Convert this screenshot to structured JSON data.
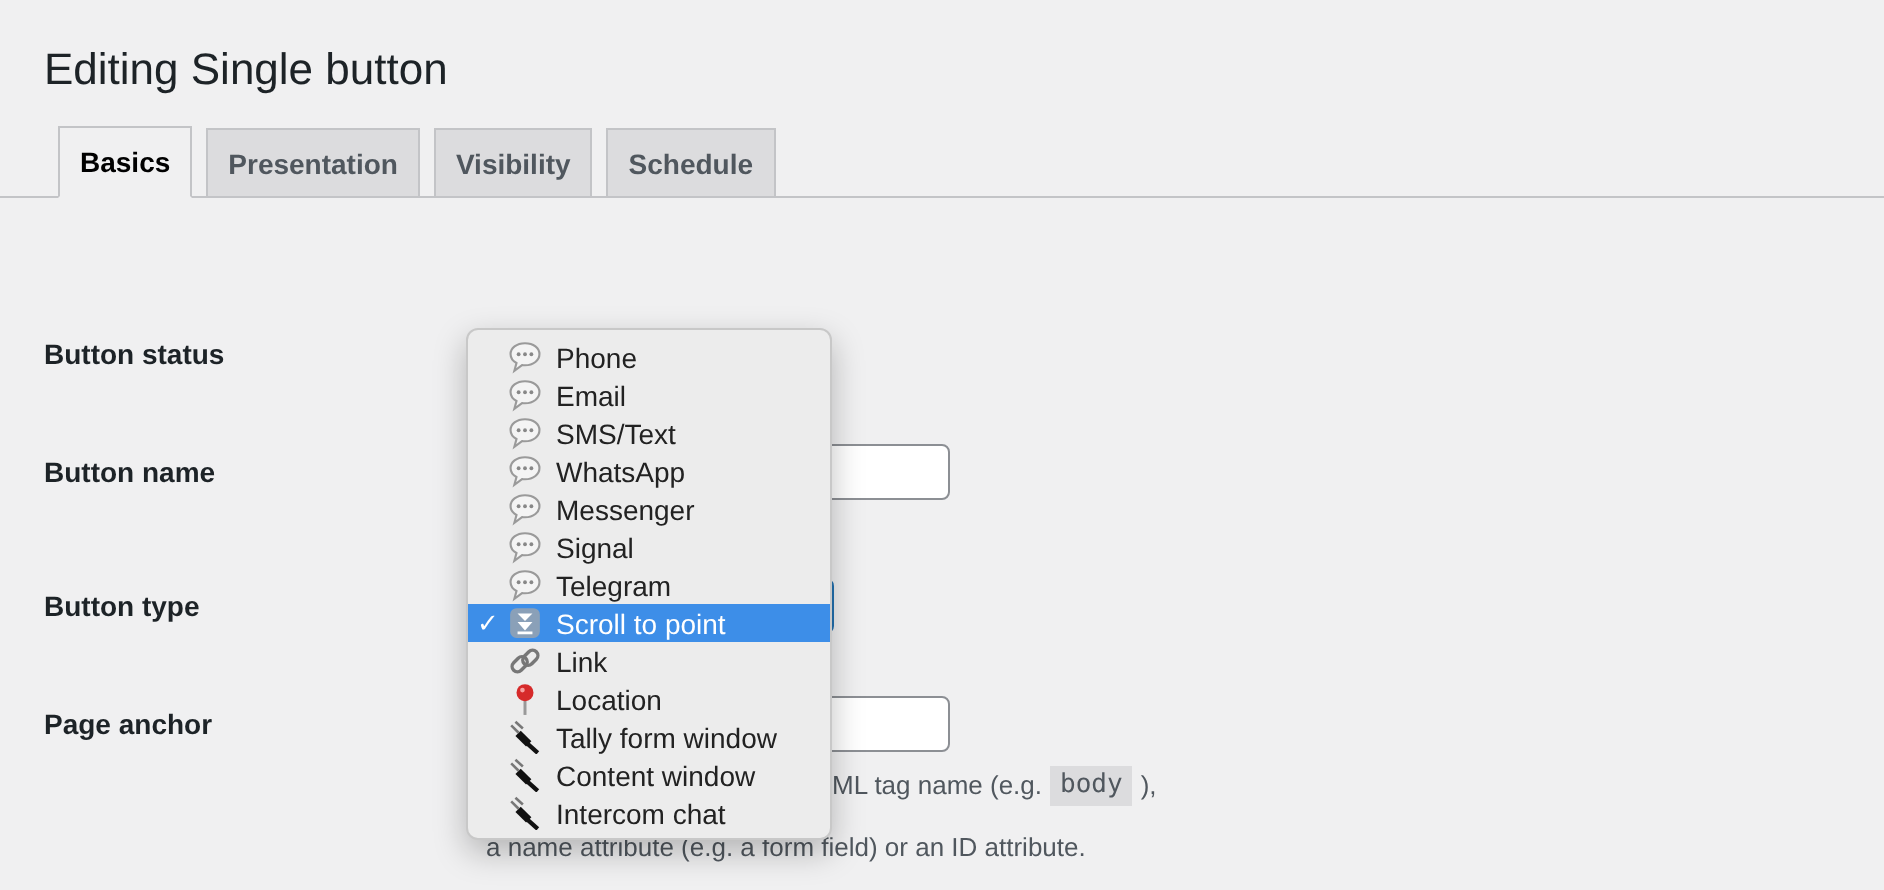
{
  "page": {
    "title": "Editing Single button"
  },
  "tabs": [
    {
      "label": "Basics",
      "selected": true
    },
    {
      "label": "Presentation",
      "selected": false
    },
    {
      "label": "Visibility",
      "selected": false
    },
    {
      "label": "Schedule",
      "selected": false
    }
  ],
  "form": {
    "rows": [
      {
        "label": "Button status"
      },
      {
        "label": "Button name",
        "kind": "text"
      },
      {
        "label": "Button type",
        "kind": "select"
      },
      {
        "label": "Page anchor",
        "kind": "text"
      }
    ],
    "help": {
      "line_1_before": "ML tag name (e.g.",
      "line_1_code": "body",
      "line_1_after": "),",
      "line_2": "a name attribute (e.g. a form field) or an ID attribute."
    }
  },
  "dropdown_menu": {
    "check": "✓",
    "items": [
      {
        "label": "Phone",
        "kind": "chat",
        "selected": false
      },
      {
        "label": "Email",
        "kind": "chat",
        "selected": false
      },
      {
        "label": "SMS/Text",
        "kind": "chat",
        "selected": false
      },
      {
        "label": "WhatsApp",
        "kind": "chat",
        "selected": false
      },
      {
        "label": "Messenger",
        "kind": "chat",
        "selected": false
      },
      {
        "label": "Signal",
        "kind": "chat",
        "selected": false
      },
      {
        "label": "Telegram",
        "kind": "chat",
        "selected": false
      },
      {
        "label": "Scroll to point",
        "kind": "scroll",
        "selected": true
      },
      {
        "label": "Link",
        "kind": "link",
        "selected": false
      },
      {
        "label": "Location",
        "kind": "pin",
        "selected": false
      },
      {
        "label": "Tally form window",
        "kind": "plug",
        "selected": false
      },
      {
        "label": "Content window",
        "kind": "plug",
        "selected": false
      },
      {
        "label": "Intercom chat",
        "kind": "plug",
        "selected": false
      }
    ]
  }
}
